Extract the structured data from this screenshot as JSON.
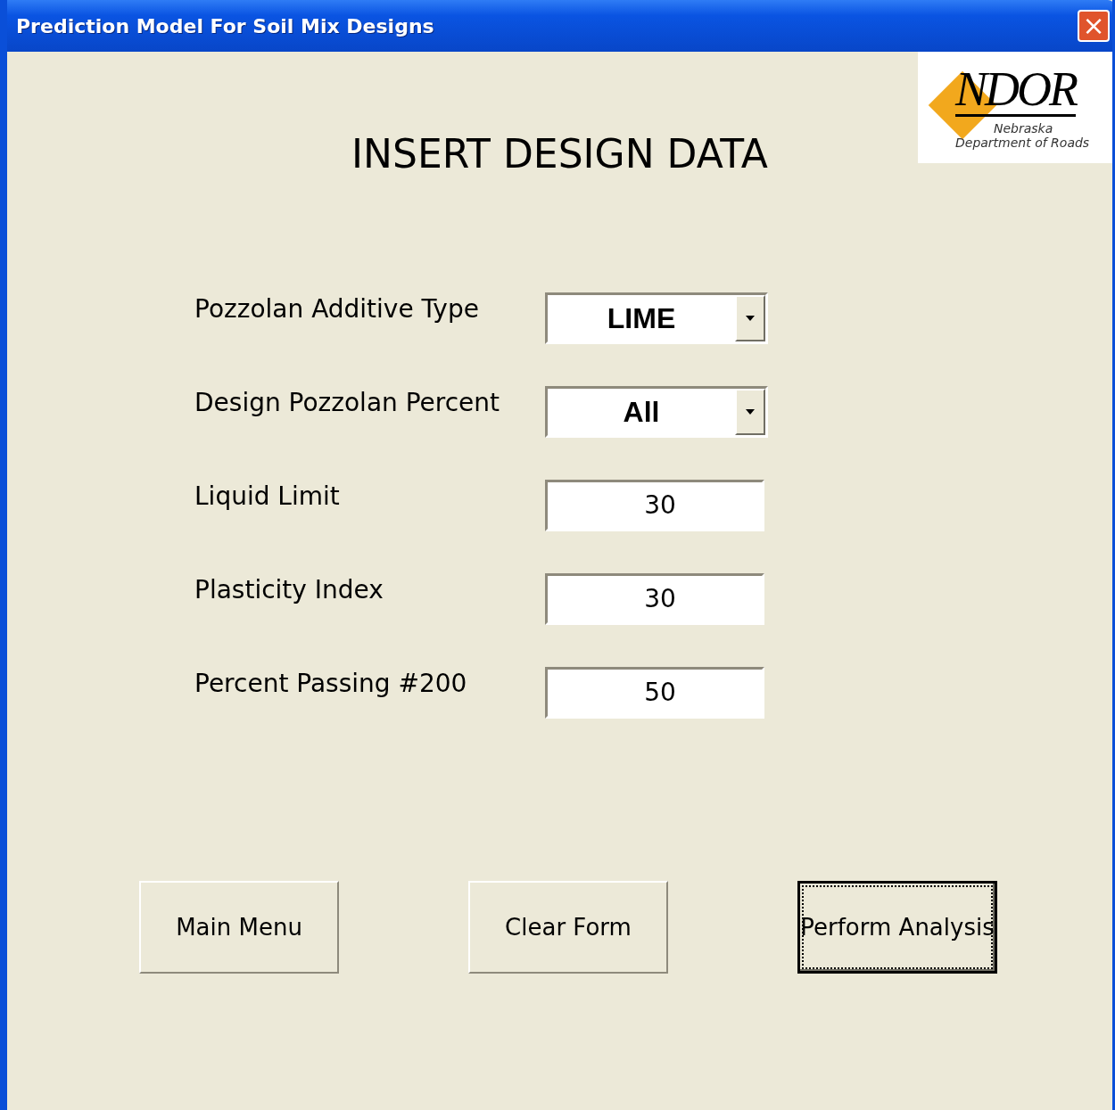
{
  "window": {
    "title": "Prediction Model For Soil Mix Designs",
    "close": "×"
  },
  "logo": {
    "name": "NDOR",
    "line1": "Nebraska",
    "line2": "Department of Roads"
  },
  "heading": "INSERT DESIGN DATA",
  "fields": [
    {
      "label": "Pozzolan Additive Type",
      "kind": "dropdown",
      "value": "LIME"
    },
    {
      "label": "Design Pozzolan Percent",
      "kind": "dropdown",
      "value": "All"
    },
    {
      "label": "Liquid Limit",
      "kind": "text",
      "value": "30"
    },
    {
      "label": "Plasticity Index",
      "kind": "text",
      "value": "30"
    },
    {
      "label": "Percent Passing #200",
      "kind": "text",
      "value": "50"
    }
  ],
  "buttons": [
    {
      "label": "Main Menu",
      "focused": false
    },
    {
      "label": "Clear Form",
      "focused": false
    },
    {
      "label": "Perform Analysis",
      "focused": true
    }
  ]
}
